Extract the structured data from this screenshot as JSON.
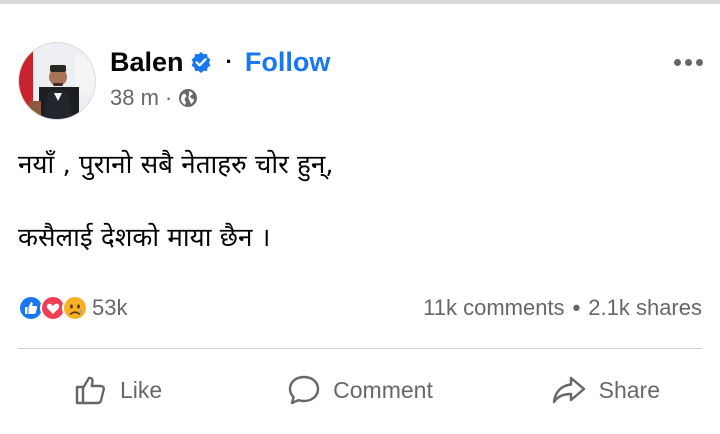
{
  "post": {
    "author_name": "Balen",
    "follow_label": "Follow",
    "separator": "·",
    "timestamp": "38 m",
    "meta_separator": "·",
    "text_line_1": "नयाँ , पुरानो सबै नेताहरु चोर हुन्,",
    "text_line_2": "कसैलाई देशको माया छैन ।"
  },
  "stats": {
    "reaction_count": "53k",
    "comments": "11k comments",
    "bullet": "•",
    "shares": "2.1k shares"
  },
  "actions": {
    "like_label": "Like",
    "comment_label": "Comment",
    "share_label": "Share"
  },
  "colors": {
    "accent": "#1877f2",
    "secondary_text": "#65676b",
    "love_red": "#f33e58",
    "sad_yellow": "#f7b125"
  },
  "icons": [
    "verified-badge-icon",
    "globe-icon",
    "more-options-icon",
    "like-reaction-icon",
    "love-reaction-icon",
    "sad-reaction-icon",
    "thumbs-up-icon",
    "comment-bubble-icon",
    "share-arrow-icon"
  ]
}
